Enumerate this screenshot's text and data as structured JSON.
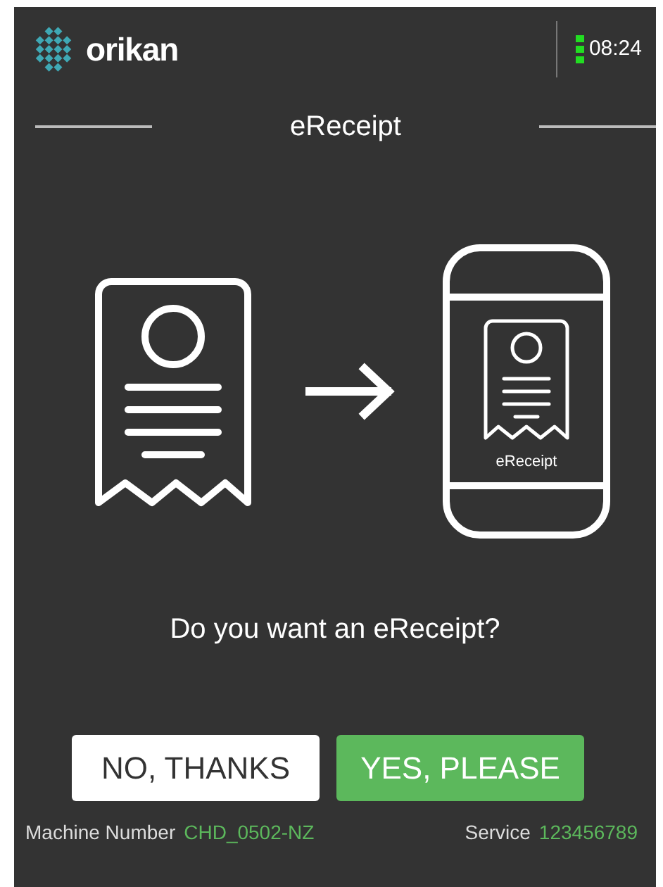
{
  "header": {
    "brand": "orikan",
    "time": "08:24"
  },
  "title": "eReceipt",
  "illustration": {
    "phone_label": "eReceipt"
  },
  "question": "Do you want an eReceipt?",
  "buttons": [
    {
      "label": "NO, THANKS",
      "kind": "secondary"
    },
    {
      "label": "YES, PLEASE",
      "kind": "primary"
    }
  ],
  "footer": [
    {
      "label": "Machine Number",
      "value": "CHD_0502-NZ"
    },
    {
      "label": "Service",
      "value": "123456789"
    }
  ]
}
